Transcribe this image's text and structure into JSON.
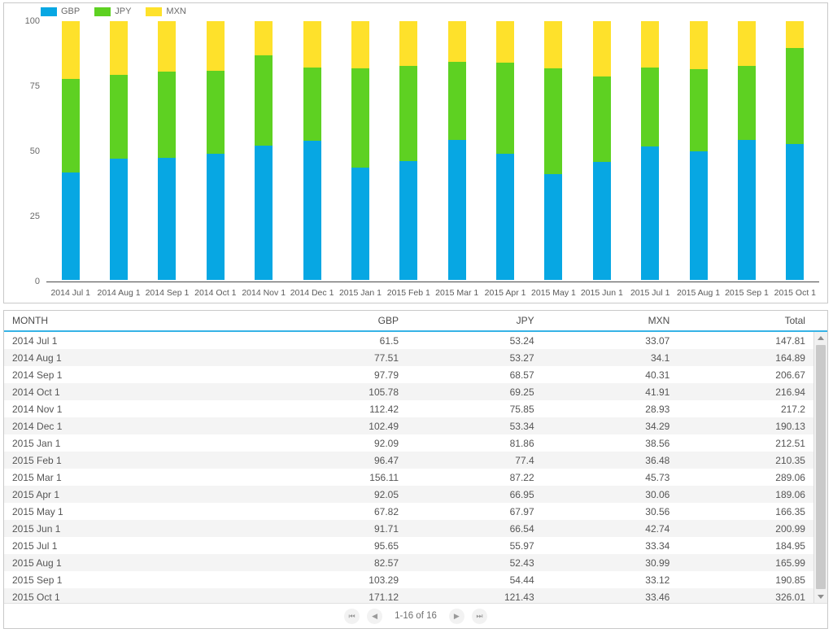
{
  "chart_data": {
    "type": "bar",
    "stacked": true,
    "normalized_percent": true,
    "title": "",
    "xlabel": "",
    "ylabel": "",
    "ylim": [
      0,
      100
    ],
    "yticks": [
      0,
      25,
      50,
      75,
      100
    ],
    "grid": false,
    "legend_position": "top-left",
    "categories": [
      "2014 Jul 1",
      "2014 Aug 1",
      "2014 Sep 1",
      "2014 Oct 1",
      "2014 Nov 1",
      "2014 Dec 1",
      "2015 Jan 1",
      "2015 Feb 1",
      "2015 Mar 1",
      "2015 Apr 1",
      "2015 May 1",
      "2015 Jun 1",
      "2015 Jul 1",
      "2015 Aug 1",
      "2015 Sep 1",
      "2015 Oct 1"
    ],
    "series": [
      {
        "name": "GBP",
        "color": "#07a7e3",
        "values": [
          61.5,
          77.51,
          97.79,
          105.78,
          112.42,
          102.49,
          92.09,
          96.47,
          156.11,
          92.05,
          67.82,
          91.71,
          95.65,
          82.57,
          103.29,
          171.12
        ]
      },
      {
        "name": "JPY",
        "color": "#5ed122",
        "values": [
          53.24,
          53.27,
          68.57,
          69.25,
          75.85,
          53.34,
          81.86,
          77.4,
          87.22,
          66.95,
          67.97,
          66.54,
          55.97,
          52.43,
          54.44,
          121.43
        ]
      },
      {
        "name": "MXN",
        "color": "#fee12b",
        "values": [
          33.07,
          34.1,
          40.31,
          41.91,
          28.93,
          34.29,
          38.56,
          36.48,
          45.73,
          30.06,
          30.56,
          42.74,
          33.34,
          30.99,
          33.12,
          33.46
        ]
      }
    ]
  },
  "legend": [
    {
      "label": "GBP",
      "color": "#07a7e3"
    },
    {
      "label": "JPY",
      "color": "#5ed122"
    },
    {
      "label": "MXN",
      "color": "#fee12b"
    }
  ],
  "table": {
    "columns": [
      "MONTH",
      "GBP",
      "JPY",
      "MXN",
      "Total"
    ],
    "rows": [
      {
        "month": "2014 Jul 1",
        "gbp": "61.5",
        "jpy": "53.24",
        "mxn": "33.07",
        "total": "147.81"
      },
      {
        "month": "2014 Aug 1",
        "gbp": "77.51",
        "jpy": "53.27",
        "mxn": "34.1",
        "total": "164.89"
      },
      {
        "month": "2014 Sep 1",
        "gbp": "97.79",
        "jpy": "68.57",
        "mxn": "40.31",
        "total": "206.67"
      },
      {
        "month": "2014 Oct 1",
        "gbp": "105.78",
        "jpy": "69.25",
        "mxn": "41.91",
        "total": "216.94"
      },
      {
        "month": "2014 Nov 1",
        "gbp": "112.42",
        "jpy": "75.85",
        "mxn": "28.93",
        "total": "217.2"
      },
      {
        "month": "2014 Dec 1",
        "gbp": "102.49",
        "jpy": "53.34",
        "mxn": "34.29",
        "total": "190.13"
      },
      {
        "month": "2015 Jan 1",
        "gbp": "92.09",
        "jpy": "81.86",
        "mxn": "38.56",
        "total": "212.51"
      },
      {
        "month": "2015 Feb 1",
        "gbp": "96.47",
        "jpy": "77.4",
        "mxn": "36.48",
        "total": "210.35"
      },
      {
        "month": "2015 Mar 1",
        "gbp": "156.11",
        "jpy": "87.22",
        "mxn": "45.73",
        "total": "289.06"
      },
      {
        "month": "2015 Apr 1",
        "gbp": "92.05",
        "jpy": "66.95",
        "mxn": "30.06",
        "total": "189.06"
      },
      {
        "month": "2015 May 1",
        "gbp": "67.82",
        "jpy": "67.97",
        "mxn": "30.56",
        "total": "166.35"
      },
      {
        "month": "2015 Jun 1",
        "gbp": "91.71",
        "jpy": "66.54",
        "mxn": "42.74",
        "total": "200.99"
      },
      {
        "month": "2015 Jul 1",
        "gbp": "95.65",
        "jpy": "55.97",
        "mxn": "33.34",
        "total": "184.95"
      },
      {
        "month": "2015 Aug 1",
        "gbp": "82.57",
        "jpy": "52.43",
        "mxn": "30.99",
        "total": "165.99"
      },
      {
        "month": "2015 Sep 1",
        "gbp": "103.29",
        "jpy": "54.44",
        "mxn": "33.12",
        "total": "190.85"
      },
      {
        "month": "2015 Oct 1",
        "gbp": "171.12",
        "jpy": "121.43",
        "mxn": "33.46",
        "total": "326.01"
      }
    ]
  },
  "pager": {
    "first_label": "⏮",
    "prev_label": "◀",
    "next_label": "▶",
    "last_label": "⏭",
    "info": "1-16 of 16"
  }
}
